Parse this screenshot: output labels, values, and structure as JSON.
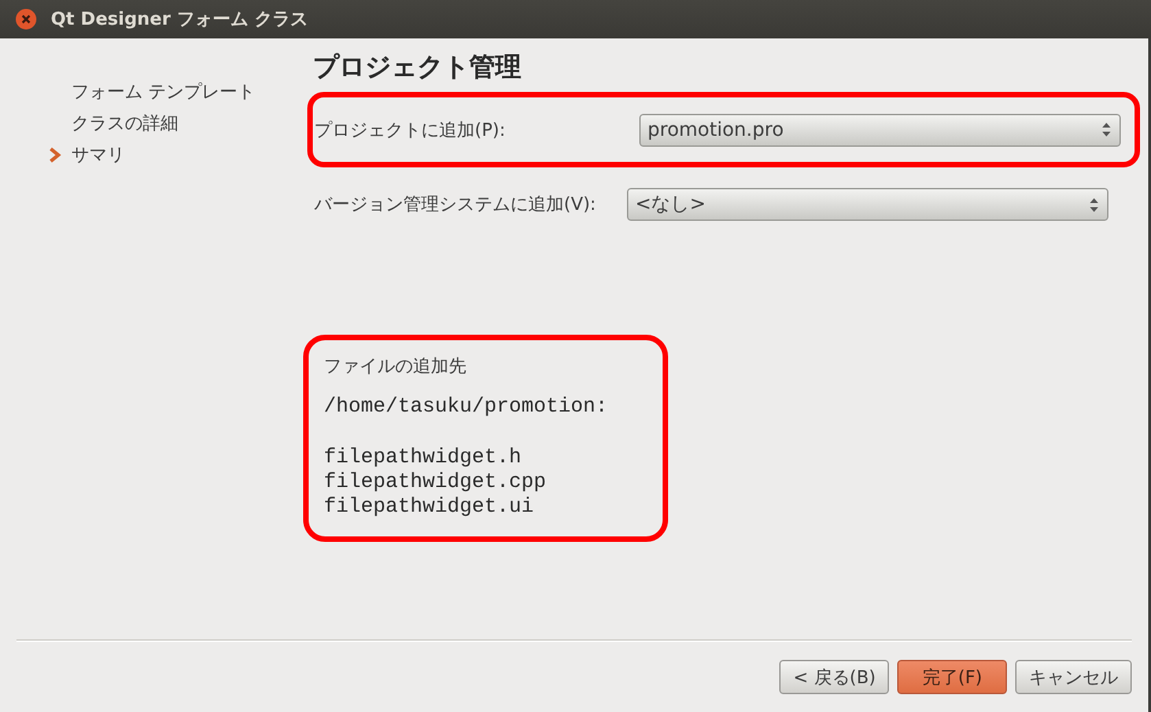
{
  "window": {
    "title": "Qt Designer フォーム クラス"
  },
  "sidebar": {
    "items": [
      {
        "label": "フォーム テンプレート",
        "selected": false
      },
      {
        "label": "クラスの詳細",
        "selected": false
      },
      {
        "label": "サマリ",
        "selected": true
      }
    ]
  },
  "page": {
    "title": "プロジェクト管理",
    "fields": [
      {
        "label": "プロジェクトに追加(P):",
        "value": "promotion.pro",
        "highlighted": true
      },
      {
        "label": "バージョン管理システムに追加(V):",
        "value": "<なし>",
        "highlighted": false
      }
    ],
    "summary": {
      "label": "ファイルの追加先",
      "path": "/home/tasuku/promotion:",
      "files": [
        "filepathwidget.h",
        "filepathwidget.cpp",
        "filepathwidget.ui"
      ],
      "highlighted": true
    }
  },
  "buttons": [
    {
      "label": "< 戻る(B)",
      "kind": "normal"
    },
    {
      "label": "完了(F)",
      "kind": "default"
    },
    {
      "label": "キャンセル",
      "kind": "normal"
    }
  ]
}
